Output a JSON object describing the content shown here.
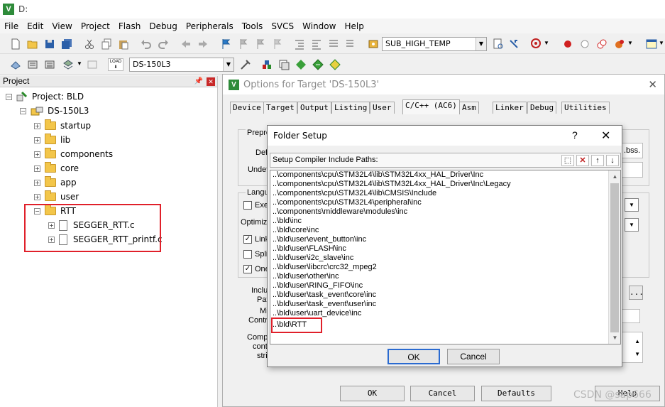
{
  "app": {
    "title": "D:"
  },
  "menu": [
    "File",
    "Edit",
    "View",
    "Project",
    "Flash",
    "Debug",
    "Peripherals",
    "Tools",
    "SVCS",
    "Window",
    "Help"
  ],
  "toolbar": {
    "target_combo": "SUB_HIGH_TEMP",
    "build_target": "DS-150L3",
    "load_label": "LOAD"
  },
  "project_panel": {
    "title": "Project",
    "root": "Project: BLD",
    "target": "DS-150L3",
    "groups": [
      "startup",
      "lib",
      "components",
      "core",
      "app",
      "user",
      "RTT"
    ],
    "rtt_files": [
      "SEGGER_RTT.c",
      "SEGGER_RTT_printf.c"
    ]
  },
  "options": {
    "title": "Options for Target 'DS-150L3'",
    "tabs": [
      "Device",
      "Target",
      "Output",
      "Listing",
      "User",
      "C/C++ (AC6)",
      "Asm",
      "Linker",
      "Debug",
      "Utilities"
    ],
    "active_tab": "C/C++ (AC6)",
    "labels": {
      "preprocessor": "Prepro",
      "define": "Def",
      "undefine": "Undef",
      "language": "Langu",
      "execute": "Exe",
      "optimization": "Optimiz",
      "link": "Link",
      "split": "Spli",
      "one": "One",
      "include": "Inclu",
      "paths": "Pat",
      "misc": "Mi",
      "controls": "Contr",
      "compiler": "Comp",
      "control": "cont",
      "string": "stri",
      "bss": ".bss."
    },
    "buttons": {
      "ok": "OK",
      "cancel": "Cancel",
      "defaults": "Defaults",
      "help": "Help",
      "browse": "..."
    }
  },
  "folder_setup": {
    "title": "Folder Setup",
    "help": "?",
    "close": "✕",
    "header": "Setup Compiler Include Paths:",
    "paths": [
      "..\\components\\cpu\\STM32L4\\lib\\STM32L4xx_HAL_Driver\\Inc",
      "..\\components\\cpu\\STM32L4\\lib\\STM32L4xx_HAL_Driver\\Inc\\Legacy",
      "..\\components\\cpu\\STM32L4\\lib\\CMSIS\\Include",
      "..\\components\\cpu\\STM32L4\\peripheral\\inc",
      "..\\components\\middleware\\modules\\inc",
      "..\\bld\\inc",
      "..\\bld\\core\\inc",
      "..\\bld\\user\\event_button\\inc",
      "..\\bld\\user\\FLASH\\inc",
      "..\\bld\\user\\i2c_slave\\inc",
      "..\\bld\\user\\libcrc\\crc32_mpeg2",
      "..\\bld\\user\\other\\inc",
      "..\\bld\\user\\RING_FIFO\\inc",
      "..\\bld\\user\\task_event\\core\\inc",
      "..\\bld\\user\\task_event\\user\\inc",
      "..\\bld\\user\\uart_device\\inc",
      "..\\bld\\RTT"
    ],
    "ok": "OK",
    "cancel": "Cancel"
  },
  "watermark": "CSDN @sap666"
}
